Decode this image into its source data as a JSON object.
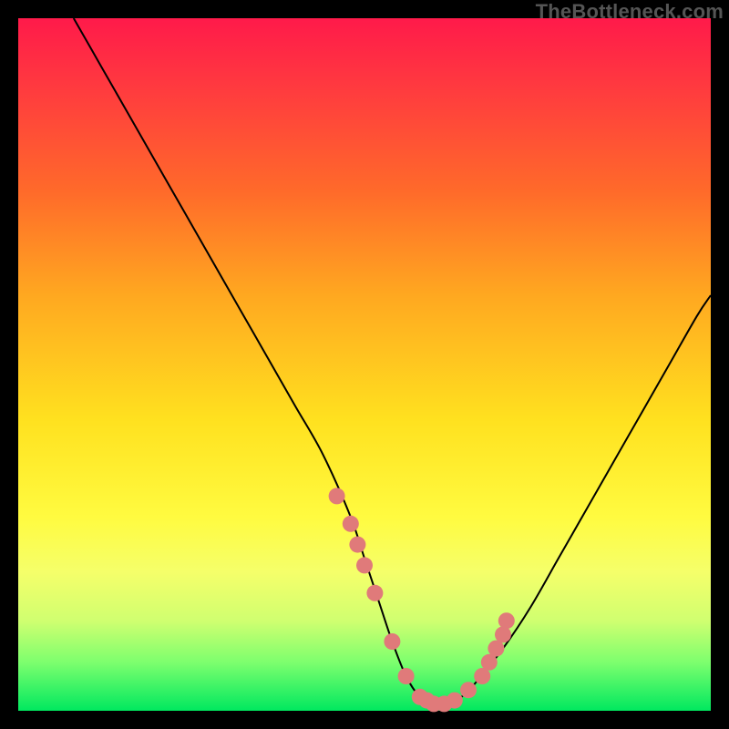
{
  "watermark": "TheBottleneck.com",
  "colors": {
    "gradient_top": "#ff1a4a",
    "gradient_bottom": "#00e85f",
    "curve": "#000000",
    "markers": "#e07a7a",
    "frame": "#000000"
  },
  "chart_data": {
    "type": "line",
    "title": "",
    "xlabel": "",
    "ylabel": "",
    "xlim": [
      0,
      100
    ],
    "ylim": [
      0,
      100
    ],
    "grid": false,
    "legend": false,
    "series": [
      {
        "name": "bottleneck-curve",
        "x": [
          8,
          12,
          16,
          20,
          24,
          28,
          32,
          36,
          40,
          44,
          48,
          50,
          52,
          54,
          56,
          58,
          60,
          62,
          64,
          66,
          70,
          74,
          78,
          82,
          86,
          90,
          94,
          98,
          100
        ],
        "values": [
          100,
          93,
          86,
          79,
          72,
          65,
          58,
          51,
          44,
          37,
          28,
          22,
          16,
          10,
          5,
          2,
          1,
          1,
          2,
          4,
          9,
          15,
          22,
          29,
          36,
          43,
          50,
          57,
          60
        ]
      }
    ],
    "markers": {
      "name": "highlighted-points",
      "x": [
        46,
        48,
        49,
        50,
        51.5,
        54,
        56,
        58,
        59,
        60,
        61.5,
        63,
        65,
        67,
        68,
        69,
        70,
        70.5
      ],
      "values": [
        31,
        27,
        24,
        21,
        17,
        10,
        5,
        2,
        1.5,
        1,
        1,
        1.5,
        3,
        5,
        7,
        9,
        11,
        13
      ]
    }
  }
}
